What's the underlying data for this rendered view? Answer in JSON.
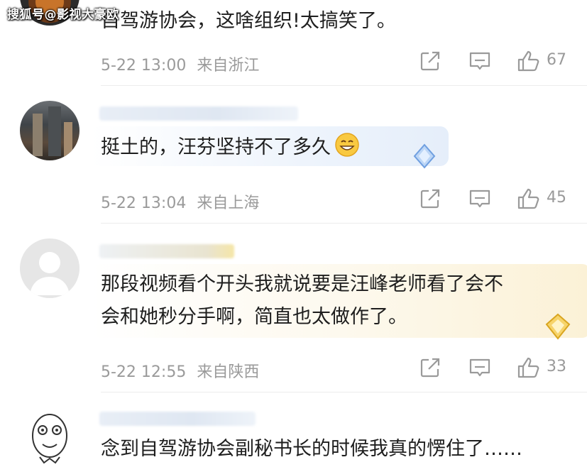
{
  "watermark": "搜狐号@影视大豪欧",
  "comments": [
    {
      "text_lines": [
        "自驾游协会，这啥组织!太搞笑了。"
      ],
      "date": "5-22 13:00",
      "location": "来自浙江",
      "likes": "67",
      "avatar": "food-avatar"
    },
    {
      "text_lines": [
        "挺土的，汪芬坚持不了多久"
      ],
      "date": "5-22 13:04",
      "location": "来自上海",
      "likes": "45",
      "avatar": "building-avatar",
      "emoji": "grinning-face"
    },
    {
      "text_lines": [
        "那段视频看个开头我就说要是汪峰老师看了会不",
        "会和她秒分手啊，简直也太做作了。"
      ],
      "date": "5-22 12:55",
      "location": "来自陕西",
      "likes": "33",
      "avatar": "default-avatar"
    },
    {
      "text_lines": [
        "念到自驾游协会副秘书长的时候我真的愣住了……"
      ],
      "avatar": "meme-face-avatar"
    }
  ],
  "colors": {
    "meta_gray": "#9a9a9a",
    "bubble_gold": "#fbf3dd",
    "bubble_blue": "#edf3fb",
    "divider": "#ececec"
  },
  "icons": {
    "share": "share-icon",
    "comment": "comment-icon",
    "like": "thumbs-up-icon"
  }
}
